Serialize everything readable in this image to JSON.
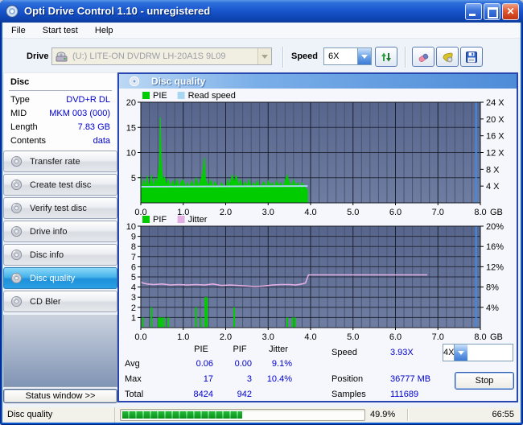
{
  "window": {
    "title": "Opti Drive Control 1.10 - unregistered",
    "menu": [
      "File",
      "Start test",
      "Help"
    ]
  },
  "icons": {
    "app": "cd-disc-icon",
    "refresh": "refresh-arrows-icon",
    "erase": "eraser-icon",
    "tools": "tools-icon",
    "save": "floppy-save-icon",
    "sidebar_buttons": "cd-disc-icon",
    "drive": "optical-drive-icon"
  },
  "toolbar": {
    "drive_label": "Drive",
    "drive_value": "(U:)  LITE-ON DVDRW LH-20A1S 9L09",
    "speed_label": "Speed",
    "speed_value": "6X"
  },
  "sidebar": {
    "disc_panel": {
      "title": "Disc",
      "rows": [
        {
          "label": "Type",
          "value": "DVD+R DL"
        },
        {
          "label": "MID",
          "value": "MKM 003 (000)"
        },
        {
          "label": "Length",
          "value": "7.83 GB"
        },
        {
          "label": "Contents",
          "value": "data"
        }
      ]
    },
    "buttons": [
      {
        "label": "Transfer rate"
      },
      {
        "label": "Create test disc"
      },
      {
        "label": "Verify test disc"
      },
      {
        "label": "Drive info"
      },
      {
        "label": "Disc info"
      },
      {
        "label": "Disc quality"
      },
      {
        "label": "CD Bler"
      }
    ],
    "active_button": "Disc quality",
    "status_button": "Status window >>"
  },
  "main": {
    "header": "Disc quality"
  },
  "stats": {
    "col_headers": [
      "PIE",
      "PIF",
      "Jitter"
    ],
    "rows": [
      {
        "label": "Avg",
        "pie": "0.06",
        "pif": "0.00",
        "jitter": "9.1%"
      },
      {
        "label": "Max",
        "pie": "17",
        "pif": "3",
        "jitter": "10.4%"
      },
      {
        "label": "Total",
        "pie": "8424",
        "pif": "942",
        "jitter": ""
      }
    ],
    "speed_label": "Speed",
    "speed_value": "3.93X",
    "position_label": "Position",
    "position_value": "36777 MB",
    "samples_label": "Samples",
    "samples_value": "111689",
    "speed_select_value": "4X",
    "stop_label": "Stop"
  },
  "statusbar": {
    "mode": "Disc quality",
    "percent": "49.9%",
    "time": "66:55",
    "progress_fraction": 0.499
  },
  "chart_data": [
    {
      "type": "area",
      "name": "PIE / Read speed",
      "x_axis": {
        "unit": "GB",
        "min": 0,
        "max": 8,
        "labels": [
          "0.0",
          "1.0",
          "2.0",
          "3.0",
          "4.0",
          "5.0",
          "6.0",
          "7.0",
          "8.0"
        ],
        "minor_step": 0.2,
        "major_step": 1.0
      },
      "y_left": {
        "min": 0,
        "max": 20,
        "ticks": [
          {
            "v": 5,
            "label": "5"
          },
          {
            "v": 10,
            "label": "10"
          },
          {
            "v": 15,
            "label": "15"
          },
          {
            "v": 20,
            "label": "20"
          }
        ]
      },
      "y_right": {
        "max": 24,
        "ticks": [
          {
            "v": 4,
            "label": "4 X"
          },
          {
            "v": 8,
            "label": "8 X"
          },
          {
            "v": 12,
            "label": "12 X"
          },
          {
            "v": 16,
            "label": "16 X"
          },
          {
            "v": 20,
            "label": "20 X"
          },
          {
            "v": 24,
            "label": "24 X"
          }
        ]
      },
      "grid_h": [
        5,
        10,
        15
      ],
      "legend": [
        {
          "label": "PIE",
          "color": "#00CC00"
        },
        {
          "label": "Read speed",
          "color": "#A9D7F2"
        }
      ],
      "pie_area": [
        [
          0,
          5.8
        ],
        [
          0.04,
          2.5
        ],
        [
          0.08,
          4.6
        ],
        [
          0.12,
          3
        ],
        [
          0.15,
          5.4
        ],
        [
          0.18,
          3.2
        ],
        [
          0.22,
          4.1
        ],
        [
          0.25,
          5.6
        ],
        [
          0.28,
          3
        ],
        [
          0.32,
          4.2
        ],
        [
          0.35,
          5
        ],
        [
          0.38,
          3.4
        ],
        [
          0.42,
          6.5
        ],
        [
          0.44,
          8
        ],
        [
          0.46,
          17
        ],
        [
          0.48,
          9
        ],
        [
          0.5,
          6
        ],
        [
          0.53,
          4.4
        ],
        [
          0.56,
          5.2
        ],
        [
          0.6,
          3.6
        ],
        [
          0.65,
          4.6
        ],
        [
          0.7,
          3
        ],
        [
          0.75,
          4.4
        ],
        [
          0.8,
          3.2
        ],
        [
          0.85,
          4.8
        ],
        [
          0.9,
          3
        ],
        [
          0.95,
          4.2
        ],
        [
          1,
          4.6
        ],
        [
          1.05,
          3
        ],
        [
          1.1,
          4
        ],
        [
          1.15,
          3.2
        ],
        [
          1.2,
          4.4
        ],
        [
          1.25,
          3
        ],
        [
          1.3,
          5
        ],
        [
          1.35,
          3.4
        ],
        [
          1.4,
          4.2
        ],
        [
          1.45,
          5.6
        ],
        [
          1.5,
          9
        ],
        [
          1.52,
          5
        ],
        [
          1.56,
          4
        ],
        [
          1.6,
          3.4
        ],
        [
          1.65,
          4.6
        ],
        [
          1.7,
          3
        ],
        [
          1.75,
          4.2
        ],
        [
          1.8,
          3.4
        ],
        [
          1.85,
          3
        ],
        [
          1.9,
          4
        ],
        [
          1.95,
          3.4
        ],
        [
          2,
          3
        ],
        [
          2.05,
          4.6
        ],
        [
          2.1,
          3.4
        ],
        [
          2.15,
          5.6
        ],
        [
          2.2,
          4
        ],
        [
          2.25,
          5.5
        ],
        [
          2.3,
          3.4
        ],
        [
          2.35,
          4.6
        ],
        [
          2.4,
          3
        ],
        [
          2.45,
          4.2
        ],
        [
          2.5,
          3.4
        ],
        [
          2.55,
          4.6
        ],
        [
          2.6,
          3
        ],
        [
          2.65,
          4
        ],
        [
          2.7,
          3.4
        ],
        [
          2.75,
          4.4
        ],
        [
          2.8,
          3
        ],
        [
          2.85,
          3.6
        ],
        [
          2.9,
          4.2
        ],
        [
          2.95,
          3
        ],
        [
          3,
          4.4
        ],
        [
          3.05,
          3.4
        ],
        [
          3.1,
          4
        ],
        [
          3.15,
          3
        ],
        [
          3.2,
          4.4
        ],
        [
          3.25,
          3.4
        ],
        [
          3.3,
          4
        ],
        [
          3.35,
          3
        ],
        [
          3.4,
          4.4
        ],
        [
          3.45,
          5.5
        ],
        [
          3.5,
          4
        ],
        [
          3.55,
          3.4
        ],
        [
          3.6,
          4.6
        ],
        [
          3.65,
          3.4
        ],
        [
          3.7,
          4
        ],
        [
          3.75,
          3
        ],
        [
          3.8,
          4
        ],
        [
          3.85,
          3.4
        ],
        [
          3.9,
          2.8
        ],
        [
          3.93,
          2.5
        ]
      ],
      "read_speed_line": [
        [
          0,
          3.2
        ],
        [
          3.93,
          3.35
        ]
      ],
      "marker_x": 7.9
    },
    {
      "type": "bar+line",
      "name": "PIF / Jitter",
      "x_axis": {
        "unit": "GB",
        "min": 0,
        "max": 8,
        "labels": [
          "0.0",
          "1.0",
          "2.0",
          "3.0",
          "4.0",
          "5.0",
          "6.0",
          "7.0",
          "8.0"
        ],
        "minor_step": 0.2,
        "major_step": 1.0
      },
      "y_left": {
        "min": 0,
        "max": 10,
        "ticks": [
          {
            "v": 1,
            "label": "1"
          },
          {
            "v": 2,
            "label": "2"
          },
          {
            "v": 3,
            "label": "3"
          },
          {
            "v": 4,
            "label": "4"
          },
          {
            "v": 5,
            "label": "5"
          },
          {
            "v": 6,
            "label": "6"
          },
          {
            "v": 7,
            "label": "7"
          },
          {
            "v": 8,
            "label": "8"
          },
          {
            "v": 9,
            "label": "9"
          },
          {
            "v": 10,
            "label": "10"
          }
        ]
      },
      "y_right": {
        "max": 20,
        "ticks": [
          {
            "v": 4,
            "label": "4%"
          },
          {
            "v": 8,
            "label": "8%"
          },
          {
            "v": 12,
            "label": "12%"
          },
          {
            "v": 16,
            "label": "16%"
          },
          {
            "v": 20,
            "label": "20%"
          }
        ]
      },
      "grid_h": [
        1,
        2,
        3,
        4,
        5,
        6,
        7,
        8,
        9
      ],
      "legend": [
        {
          "label": "PIF",
          "color": "#00CC00"
        },
        {
          "label": "Jitter",
          "color": "#E3AEE3"
        }
      ],
      "pif_bars": [
        [
          0.05,
          1
        ],
        [
          0.25,
          2
        ],
        [
          0.42,
          1
        ],
        [
          0.46,
          1
        ],
        [
          0.5,
          1
        ],
        [
          0.55,
          1
        ],
        [
          0.65,
          1
        ],
        [
          1.3,
          2
        ],
        [
          1.42,
          1
        ],
        [
          1.52,
          3
        ],
        [
          1.56,
          3
        ],
        [
          2.2,
          2
        ],
        [
          3.45,
          1
        ],
        [
          3.58,
          1
        ],
        [
          3.63,
          1
        ]
      ],
      "jitter_line": [
        [
          0,
          4.5
        ],
        [
          0.05,
          4.4
        ],
        [
          0.15,
          4.3
        ],
        [
          0.3,
          4.25
        ],
        [
          0.5,
          4.3
        ],
        [
          0.7,
          4.2
        ],
        [
          0.9,
          4.25
        ],
        [
          1.1,
          4.2
        ],
        [
          1.3,
          4.25
        ],
        [
          1.5,
          4.2
        ],
        [
          1.7,
          4.3
        ],
        [
          1.9,
          4.15
        ],
        [
          2.1,
          4.2
        ],
        [
          2.3,
          4.15
        ],
        [
          2.5,
          4.1
        ],
        [
          2.7,
          4.05
        ],
        [
          2.9,
          4.1
        ],
        [
          3.1,
          4.2
        ],
        [
          3.3,
          4.25
        ],
        [
          3.5,
          4.25
        ],
        [
          3.65,
          4.2
        ],
        [
          3.8,
          4.3
        ],
        [
          3.88,
          4.4
        ],
        [
          3.95,
          5.2
        ],
        [
          6.75,
          5.2
        ]
      ],
      "marker_x": 7.9
    }
  ]
}
